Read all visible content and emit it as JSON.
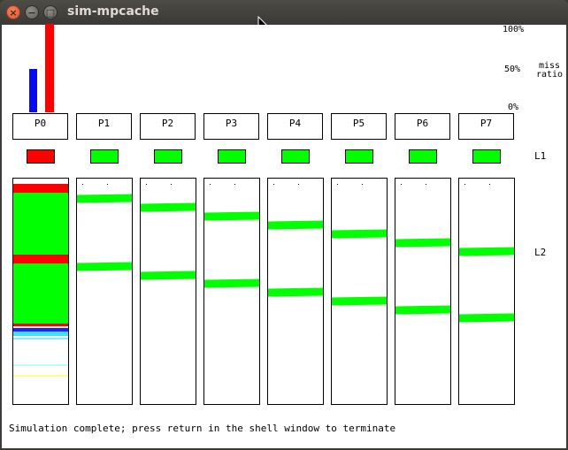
{
  "window": {
    "title": "sim-mpcache"
  },
  "legend": {
    "pct_top": "100%",
    "pct_mid": "50%",
    "pct_bottom": "0%",
    "miss_ratio_line1": "miss",
    "miss_ratio_line2": "ratio",
    "level_l1": "L1",
    "level_l2": "L2"
  },
  "colors": {
    "l1_miss_bar": "#0a0aee",
    "l2_miss_bar": "#ff0000",
    "ok": "#00ff00",
    "conflict": "#ff0000",
    "invalid": "#ffffff"
  },
  "miss_ratio": {
    "l1": 0.49,
    "l2": 1.0
  },
  "processors": [
    {
      "label": "P0",
      "l1_state": "conflict"
    },
    {
      "label": "P1",
      "l1_state": "ok"
    },
    {
      "label": "P2",
      "l1_state": "ok"
    },
    {
      "label": "P3",
      "l1_state": "ok"
    },
    {
      "label": "P4",
      "l1_state": "ok"
    },
    {
      "label": "P5",
      "l1_state": "ok"
    },
    {
      "label": "P6",
      "l1_state": "ok"
    },
    {
      "label": "P7",
      "l1_state": "ok"
    }
  ],
  "status": "Simulation complete; press return in the shell window to terminate"
}
